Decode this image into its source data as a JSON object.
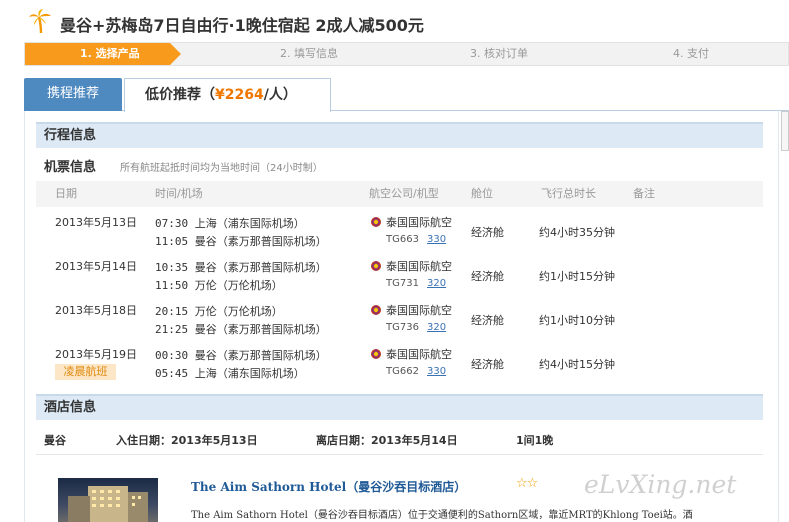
{
  "header": {
    "title": "曼谷+苏梅岛7日自由行·1晚住宿起 2成人减500元",
    "logo_icon": "palm-tree-logo-icon"
  },
  "steps": [
    "1. 选择产品",
    "2. 填写信息",
    "3. 核对订单",
    "4. 支付"
  ],
  "tabs": {
    "tab1_label": "携程推荐",
    "tab2_label": "低价推荐（",
    "tab2_price": "¥2264",
    "tab2_unit": "/人）"
  },
  "itinerary": {
    "title": "行程信息",
    "flight_title": "机票信息",
    "flight_note": "所有航班起抵时间均为当地时间（24小时制）",
    "columns": [
      "日期",
      "时间/机场",
      "航空公司/机型",
      "舱位",
      "飞行总时长",
      "备注"
    ],
    "flights": [
      {
        "date": "2013年5月13日",
        "dep": "07:30 上海（浦东国际机场）",
        "arr": "11:05 曼谷（素万那普国际机场）",
        "airline": "泰国国际航空",
        "flight_no": "TG663",
        "plane": "330",
        "cabin": "经济舱",
        "duration": "约4小时35分钟",
        "tag": ""
      },
      {
        "date": "2013年5月14日",
        "dep": "10:35 曼谷（素万那普国际机场）",
        "arr": "11:50 万伦（万伦机场）",
        "airline": "泰国国际航空",
        "flight_no": "TG731",
        "plane": "320",
        "cabin": "经济舱",
        "duration": "约1小时15分钟",
        "tag": ""
      },
      {
        "date": "2013年5月18日",
        "dep": "20:15 万伦（万伦机场）",
        "arr": "21:25 曼谷（素万那普国际机场）",
        "airline": "泰国国际航空",
        "flight_no": "TG736",
        "plane": "320",
        "cabin": "经济舱",
        "duration": "约1小时10分钟",
        "tag": ""
      },
      {
        "date": "2013年5月19日",
        "dep": "00:30 曼谷（素万那普国际机场）",
        "arr": "05:45 上海（浦东国际机场）",
        "airline": "泰国国际航空",
        "flight_no": "TG662",
        "plane": "330",
        "cabin": "经济舱",
        "duration": "约4小时15分钟",
        "tag": "凌晨航班"
      }
    ],
    "airline_icon": "thai-airways-icon"
  },
  "hotel": {
    "title": "酒店信息",
    "city": "曼谷",
    "checkin_label": "入住日期：",
    "checkin": "2013年5月13日",
    "checkout_label": "离店日期：",
    "checkout": "2013年5月14日",
    "rooms": "1间1晚",
    "name": "The Aim Sathorn Hotel（曼谷沙吞目标酒店）",
    "stars": "☆☆",
    "description": "The Aim Sathorn Hotel（曼谷沙吞目标酒店）位于交通便利的Sathorn区域，靠近MRT的Khlong Toei站。酒"
  },
  "watermark": "eLvXing.net",
  "colors": {
    "accent_orange": "#f89a1c",
    "tab_blue": "#4e89c0",
    "price_orange": "#f07800",
    "section_bg": "#ddeaf6",
    "link_blue": "#1f5a97"
  }
}
